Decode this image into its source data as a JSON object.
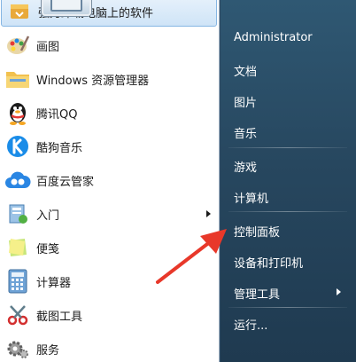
{
  "programs": {
    "items": [
      {
        "label": "强力卸载电脑上的软件",
        "icon": "uninstall-box-icon"
      },
      {
        "label": "画图",
        "icon": "paint-palette-icon"
      },
      {
        "label": "Windows 资源管理器",
        "icon": "folder-explorer-icon"
      },
      {
        "label": "腾讯QQ",
        "icon": "qq-penguin-icon"
      },
      {
        "label": "酷狗音乐",
        "icon": "kugou-k-icon"
      },
      {
        "label": "百度云管家",
        "icon": "baidu-cloud-icon"
      },
      {
        "label": "入门",
        "icon": "getting-started-icon"
      },
      {
        "label": "便笺",
        "icon": "sticky-note-icon"
      },
      {
        "label": "计算器",
        "icon": "calculator-icon"
      },
      {
        "label": "截图工具",
        "icon": "scissors-icon"
      },
      {
        "label": "服务",
        "icon": "gears-icon"
      }
    ]
  },
  "right_menu": {
    "user": "Administrator",
    "items": [
      "文档",
      "图片",
      "音乐",
      "游戏",
      "计算机",
      "控制面板",
      "设备和打印机",
      "管理工具",
      "运行..."
    ]
  },
  "colors": {
    "highlight": "#cfe4f7",
    "right_pane": "#27475f",
    "annotation_arrow": "#e8382a"
  }
}
